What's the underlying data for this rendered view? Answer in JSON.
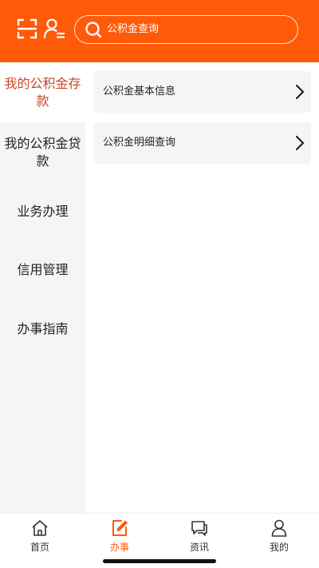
{
  "colors": {
    "brand": "#ff5a0a",
    "active_text": "#c7472a",
    "sidebar_bg": "#f5f5f5",
    "card_bg": "#f5f5f5"
  },
  "header": {
    "scan_icon": "scan-icon",
    "user_icon": "user-switch-icon",
    "search": {
      "placeholder": "公积金查询",
      "value": "",
      "icon": "search-icon"
    }
  },
  "sidebar": {
    "items": [
      {
        "label": "我的公积金存款",
        "active": true
      },
      {
        "label": "我的公积金贷款",
        "active": false
      },
      {
        "label": "业务办理",
        "active": false
      },
      {
        "label": "信用管理",
        "active": false
      },
      {
        "label": "办事指南",
        "active": false
      }
    ]
  },
  "main": {
    "cards": [
      {
        "label": "公积金基本信息",
        "icon": "chevron-right-icon"
      },
      {
        "label": "公积金明细查询",
        "icon": "chevron-right-icon"
      }
    ]
  },
  "tabbar": {
    "tabs": [
      {
        "label": "首页",
        "icon": "home-icon",
        "active": false
      },
      {
        "label": "办事",
        "icon": "edit-icon",
        "active": true
      },
      {
        "label": "资讯",
        "icon": "chat-icon",
        "active": false
      },
      {
        "label": "我的",
        "icon": "person-icon",
        "active": false
      }
    ]
  }
}
